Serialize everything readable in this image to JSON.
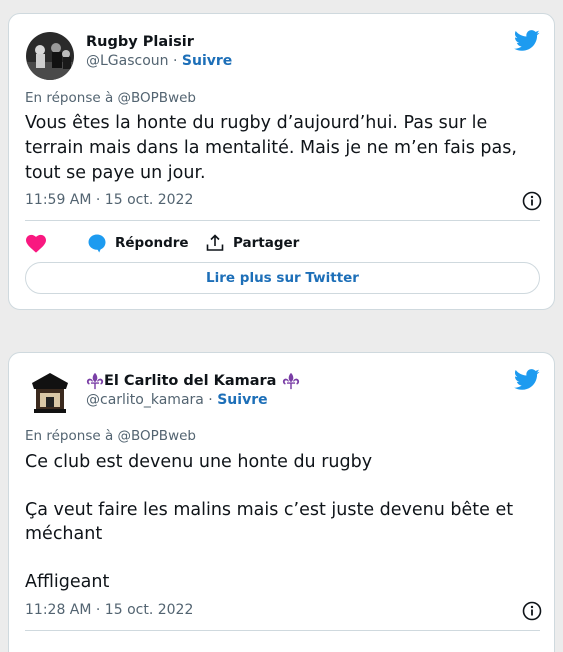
{
  "tweets": [
    {
      "display_name": "Rugby Plaisir",
      "handle": "@LGascoun",
      "separator": " · ",
      "follow": "Suivre",
      "reply_to": "En réponse à @BOPBweb",
      "text": "Vous êtes la honte du rugby d’aujourd’hui. Pas sur le terrain mais dans la mentalité. Mais je ne m’en fais pas, tout se paye un jour.",
      "timestamp": "11:59 AM · 15 oct. 2022",
      "reply_label": "Répondre",
      "share_label": "Partager",
      "read_more": "Lire plus sur Twitter"
    },
    {
      "display_name": "El Carlito del Kamara",
      "handle": "@carlito_kamara",
      "separator": " · ",
      "follow": "Suivre",
      "reply_to": "En réponse à @BOPBweb",
      "text": "Ce club est devenu une honte du rugby\n\nÇa veut faire les malins mais c’est juste devenu bête et méchant\n\nAffligeant",
      "timestamp": "11:28 AM · 15 oct. 2022"
    }
  ],
  "colors": {
    "twitter_blue": "#1d9bf0",
    "link_blue": "#1d6fb8",
    "like_red": "#f91880",
    "fleur_purple": "#7a3fa6"
  },
  "icons": [
    "twitter-bird-icon",
    "info-icon",
    "heart-icon",
    "reply-bubble-icon",
    "share-icon",
    "fleur-de-lys-icon"
  ]
}
